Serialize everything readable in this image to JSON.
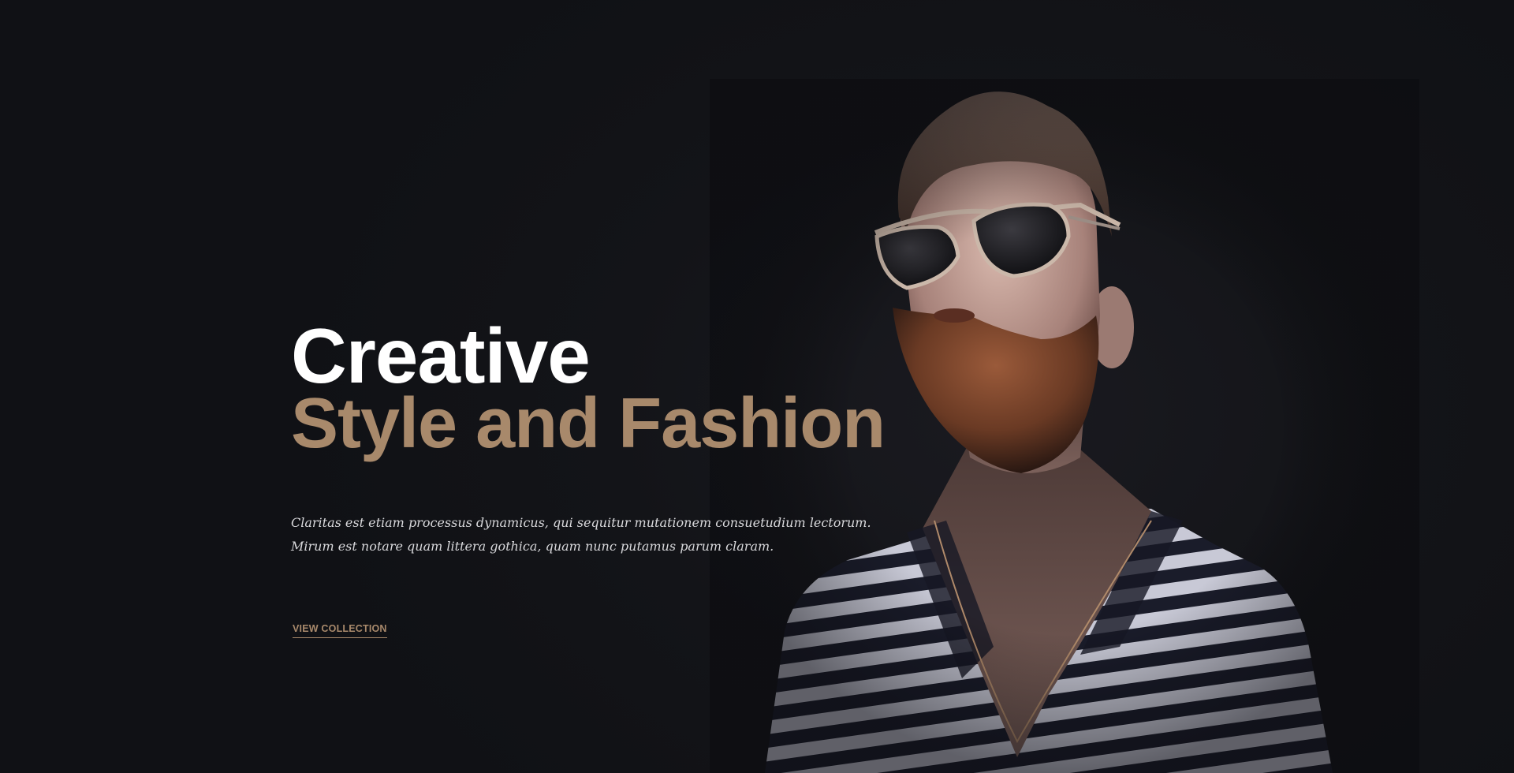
{
  "hero": {
    "headline_line1": "Creative",
    "headline_line2": "Style and Fashion",
    "description_line1": "Claritas est etiam processus dynamicus, qui sequitur mutationem consuetudium lectorum.",
    "description_line2": "Mirum est notare quam littera gothica, quam nunc putamus parum claram.",
    "cta_label": "VIEW COLLECTION"
  },
  "colors": {
    "background": "#121317",
    "accent": "#a8896b",
    "headline_primary": "#ffffff",
    "body_text": "#d9d9dc"
  }
}
